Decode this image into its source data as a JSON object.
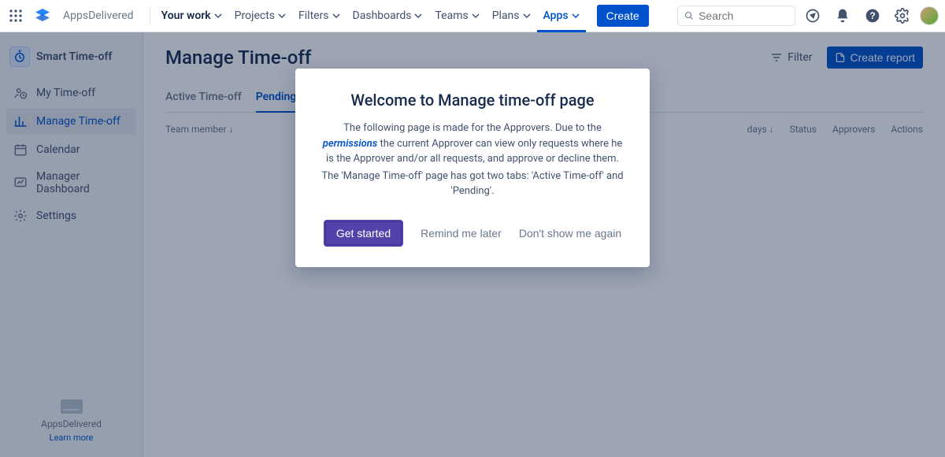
{
  "topbar": {
    "brand": "AppsDelivered",
    "nav": [
      {
        "label": "Your work",
        "bold": true
      },
      {
        "label": "Projects"
      },
      {
        "label": "Filters"
      },
      {
        "label": "Dashboards"
      },
      {
        "label": "Teams"
      },
      {
        "label": "Plans"
      },
      {
        "label": "Apps",
        "active": true
      }
    ],
    "create": "Create",
    "search_placeholder": "Search"
  },
  "sidebar": {
    "app_title": "Smart Time-off",
    "items": [
      {
        "label": "My Time-off"
      },
      {
        "label": "Manage Time-off",
        "selected": true
      },
      {
        "label": "Calendar"
      },
      {
        "label": "Manager Dashboard"
      },
      {
        "label": "Settings"
      }
    ],
    "footer_brand": "AppsDelivered",
    "footer_learn": "Learn more"
  },
  "page": {
    "title": "Manage Time-off",
    "filter_label": "Filter",
    "create_report_label": "Create report",
    "tabs": [
      {
        "label": "Active Time-off"
      },
      {
        "label": "Pending",
        "active": true
      }
    ],
    "columns": {
      "team_member": "Team member ↓",
      "days": "days ↓",
      "status": "Status",
      "approvers": "Approvers",
      "actions": "Actions"
    }
  },
  "modal": {
    "title": "Welcome to Manage time-off page",
    "line1_pre": "The following page is made for the Approvers. Due to the ",
    "permissions_link": "permissions",
    "line1_post": " the current Approver can view only requests where he is the Approver and/or all requests, and approve or decline them.",
    "line2": "The 'Manage Time-off' page has got two tabs: 'Active Time-off' and 'Pending'.",
    "get_started": "Get started",
    "remind": "Remind me later",
    "dont_show": "Don't show me again"
  }
}
